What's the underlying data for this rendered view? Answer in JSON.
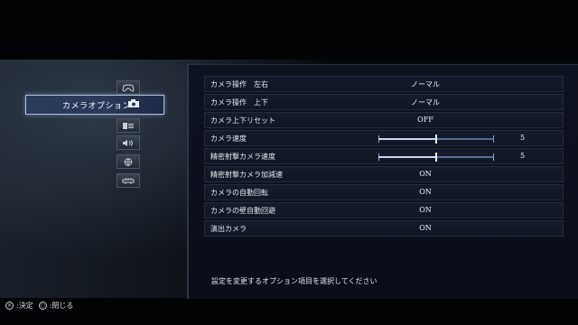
{
  "sidebar": {
    "selected_label": "カメラオプション",
    "categories": [
      {
        "icon": "gamepad-icon"
      },
      {
        "icon": "camera-icon"
      },
      {
        "icon": "display-icon"
      },
      {
        "icon": "speaker-icon"
      },
      {
        "icon": "globe-icon"
      },
      {
        "icon": "network-icon"
      }
    ]
  },
  "options": [
    {
      "label": "カメラ操作　左右",
      "value": "ノーマル"
    },
    {
      "label": "カメラ操作　上下",
      "value": "ノーマル"
    },
    {
      "label": "カメラ上下リセット",
      "value": "OFF"
    },
    {
      "label": "カメラ速度",
      "slider": 0.5,
      "value": "5"
    },
    {
      "label": "精密射撃カメラ速度",
      "slider": 0.5,
      "value": "5"
    },
    {
      "label": "精密射撃カメラ加減速",
      "value": "ON"
    },
    {
      "label": "カメラの自動回転",
      "value": "ON"
    },
    {
      "label": "カメラの壁自動回避",
      "value": "ON"
    },
    {
      "label": "演出カメラ",
      "value": "ON"
    }
  ],
  "help_text": "設定を変更するオプション項目を選択してください",
  "footer": {
    "confirm_label": ":決定",
    "close_label": ":閉じる"
  },
  "colors": {
    "accent": "#aebbd4",
    "panel": "#0e1320",
    "slider_track": "#5b6e93"
  }
}
